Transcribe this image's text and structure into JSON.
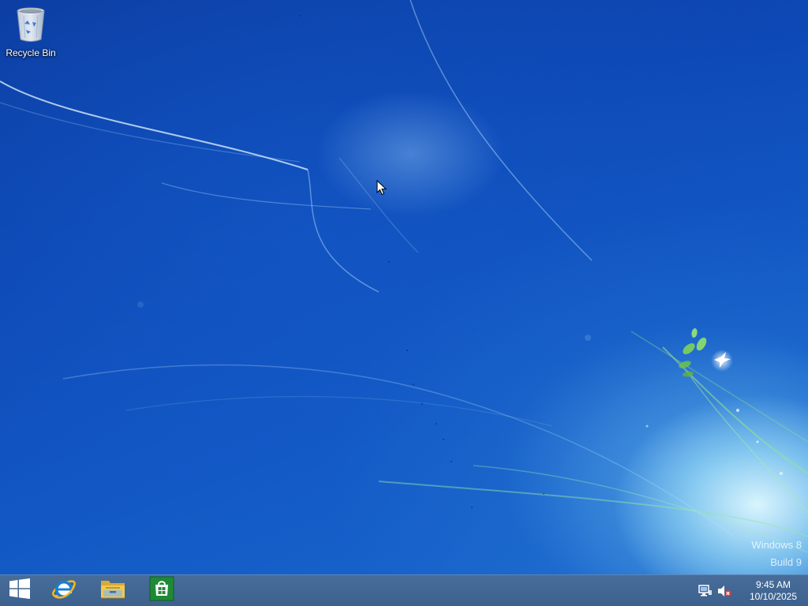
{
  "desktop": {
    "icons": [
      {
        "label": "Recycle Bin",
        "icon": "recycle-bin-icon"
      }
    ],
    "watermark": {
      "line1": "Windows 8",
      "line2": "Build 9"
    }
  },
  "taskbar": {
    "start_icon": "windows-logo-icon",
    "pinned": [
      {
        "name": "Internet Explorer",
        "icon": "internet-explorer-icon"
      },
      {
        "name": "File Explorer",
        "icon": "folder-icon"
      },
      {
        "name": "Store",
        "icon": "store-icon"
      }
    ],
    "tray": {
      "icons": [
        "network-icon",
        "volume-muted-icon"
      ],
      "time": "9:45 AM",
      "date": "10/10/2025"
    }
  },
  "colors": {
    "taskbar": "#426896",
    "wallpaper_base": "#0d48b5",
    "store_green": "#1f8a36",
    "ie_blue": "#1a7fd4",
    "folder_yellow": "#f2c94c"
  }
}
